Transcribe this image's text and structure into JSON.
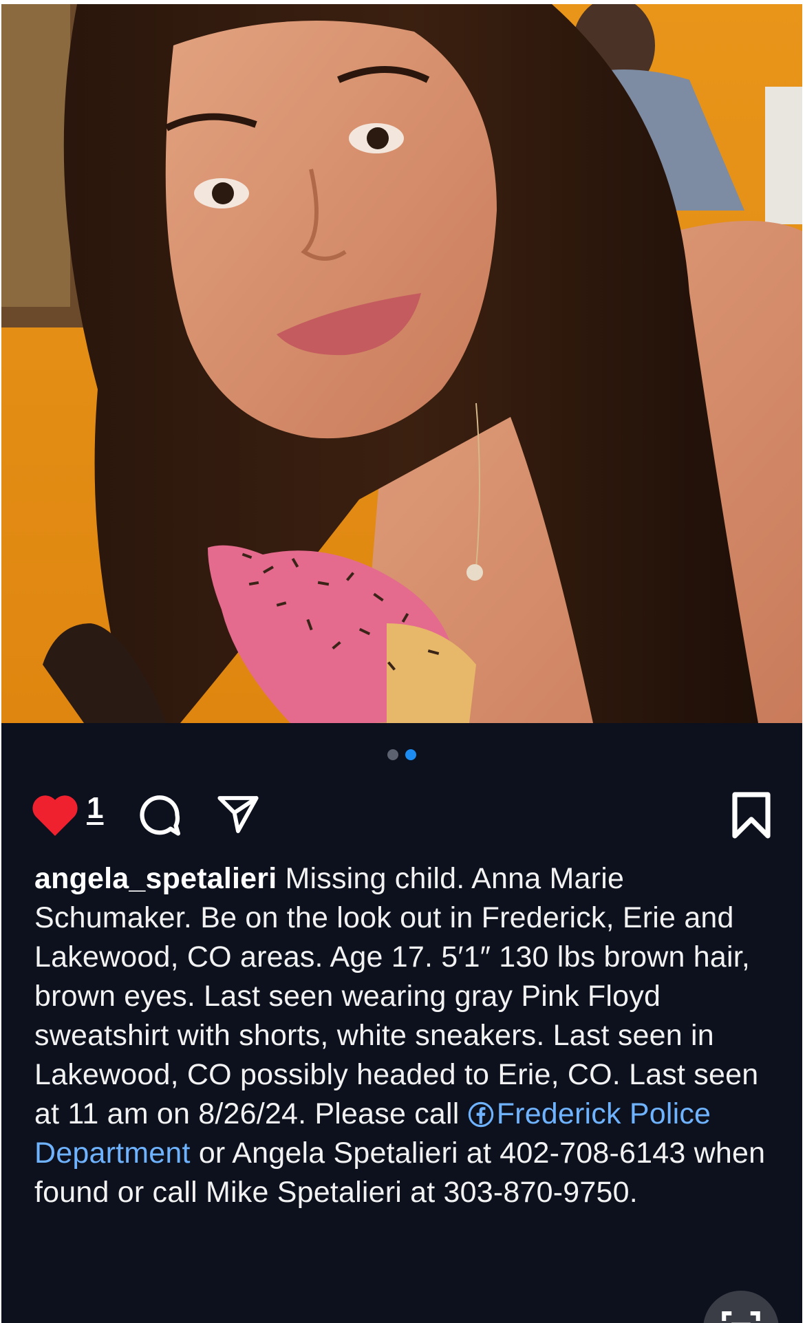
{
  "post": {
    "carousel": {
      "count": 2,
      "active_index": 1
    },
    "actions": {
      "like_count": "1",
      "liked": true,
      "icons": [
        "heart-icon",
        "comment-icon",
        "share-icon",
        "bookmark-icon"
      ]
    },
    "caption": {
      "username": "angela_spetalieri",
      "text_part1": " Missing child. Anna Marie Schumaker. Be on the look out in Frederick, Erie and Lakewood, CO areas. Age 17. 5′1″ 130 lbs brown hair, brown eyes. Last seen wearing gray Pink Floyd sweatshirt with shorts, white sneakers. Last seen in Lakewood, CO possibly headed to Erie, CO. Last seen at 11 am on 8/26/24. Please call ",
      "mention_link": "Frederick Police Department",
      "text_part2": " or Angela Spetalieri at 402-708-6143 when found or call Mike Spetalieri at  303-870-9750."
    },
    "colors": {
      "background": "#0c111d",
      "like_red": "#f0212f",
      "link_blue": "#6fb3ff",
      "dot_active": "#1d8cf2"
    }
  }
}
